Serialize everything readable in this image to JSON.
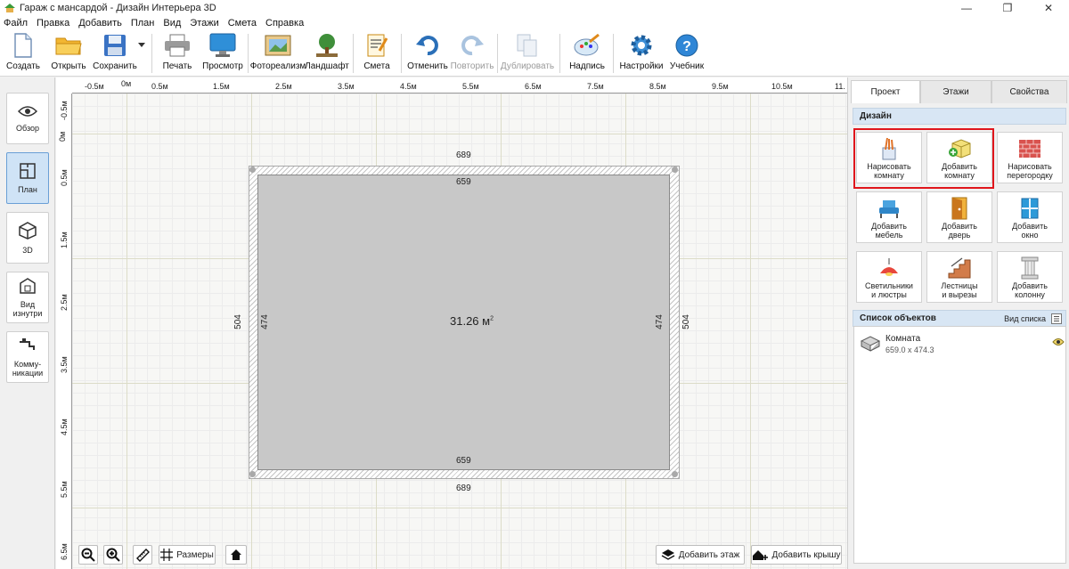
{
  "window": {
    "title": "Гараж с мансардой - Дизайн Интерьера 3D",
    "minimize_glyph": "—",
    "maximize_glyph": "❐",
    "close_glyph": "✕"
  },
  "menu": [
    "Файл",
    "Правка",
    "Добавить",
    "План",
    "Вид",
    "Этажи",
    "Смета",
    "Справка"
  ],
  "toolbar": {
    "create": "Создать",
    "open": "Открыть",
    "save": "Сохранить",
    "print": "Печать",
    "preview": "Просмотр",
    "photoreal": "Фотореализм",
    "landscape": "Ландшафт",
    "estimate": "Смета",
    "undo": "Отменить",
    "redo": "Повторить",
    "duplicate": "Дублировать",
    "caption": "Надпись",
    "settings": "Настройки",
    "tutorial": "Учебник"
  },
  "left_panel": {
    "overview": "Обзор",
    "plan": "План",
    "view3d": "3D",
    "inside": "Вид\nизнутри",
    "utilities": "Комму-\nникации"
  },
  "ruler": {
    "horizontal": [
      "-0.5м",
      "0м",
      "0.5м",
      "1.5м",
      "2.5м",
      "3.5м",
      "4.5м",
      "5.5м",
      "6.5м",
      "7.5м",
      "8.5м",
      "9.5м",
      "10.5м",
      "11."
    ],
    "vertical": [
      "-0.5м",
      "0м",
      "0.5м",
      "1.5м",
      "2.5м",
      "3.5м",
      "4.5м",
      "5.5м",
      "6.5м"
    ]
  },
  "room": {
    "outer_width": "689",
    "inner_width": "659",
    "outer_height": "504",
    "inner_height": "474",
    "area": "31.26 м",
    "area_unit_sup": "2"
  },
  "canvas_buttons": {
    "dimensions": "Размеры",
    "add_floor": "Добавить этаж",
    "add_roof": "Добавить крышу"
  },
  "right_panel": {
    "tabs": [
      "Проект",
      "Этажи",
      "Свойства"
    ],
    "design_header": "Дизайн",
    "design_buttons": [
      "Нарисовать\nкомнату",
      "Добавить\nкомнату",
      "Нарисовать\nперегородку",
      "Добавить\nмебель",
      "Добавить\nдверь",
      "Добавить\nокно",
      "Светильники\nи люстры",
      "Лестницы\nи вырезы",
      "Добавить\nколонну"
    ],
    "objects_header": "Список объектов",
    "list_view": "Вид списка",
    "objects": [
      {
        "name": "Комната",
        "size": "659.0 x 474.3"
      }
    ]
  },
  "colors": {
    "accent_highlight": "#e0161c",
    "section_header": "#d8e6f4",
    "active_left_button": "#cfe3f6",
    "room_floor": "#c8c8c8"
  }
}
